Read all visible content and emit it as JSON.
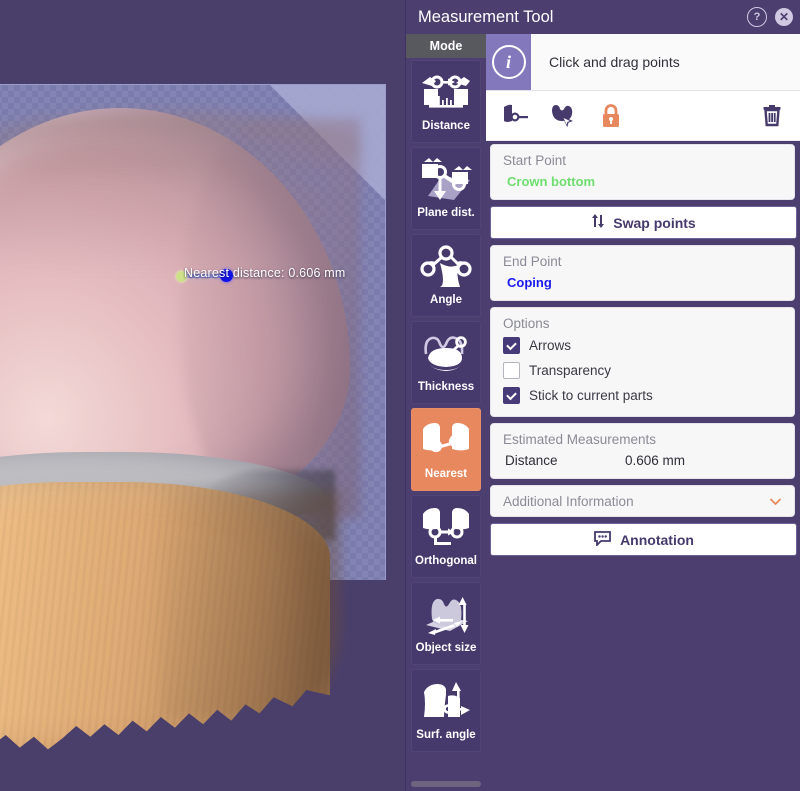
{
  "window": {
    "title": "Measurement Tool",
    "help_icon": "?",
    "close_icon": "✕"
  },
  "rail": {
    "header": "Mode",
    "items": [
      {
        "label": "Distance",
        "icon": "distance-icon",
        "active": false
      },
      {
        "label": "Plane dist.",
        "icon": "plane-distance-icon",
        "active": false
      },
      {
        "label": "Angle",
        "icon": "angle-icon",
        "active": false
      },
      {
        "label": "Thickness",
        "icon": "thickness-icon",
        "active": false
      },
      {
        "label": "Nearest",
        "icon": "nearest-icon",
        "active": true
      },
      {
        "label": "Orthogonal",
        "icon": "orthogonal-icon",
        "active": false
      },
      {
        "label": "Object size",
        "icon": "object-size-icon",
        "active": false
      },
      {
        "label": "Surf. angle",
        "icon": "surface-angle-icon",
        "active": false
      }
    ]
  },
  "info": {
    "icon": "info-icon",
    "text": "Click and drag points"
  },
  "toolbar": {
    "tools": [
      {
        "name": "pick-point-icon"
      },
      {
        "name": "select-part-icon"
      },
      {
        "name": "lock-icon"
      },
      {
        "name": "delete-icon"
      }
    ]
  },
  "start_point": {
    "title": "Start Point",
    "value": "Crown bottom"
  },
  "swap": {
    "label": "Swap points",
    "icon": "swap-arrows-icon"
  },
  "end_point": {
    "title": "End Point",
    "value": "Coping"
  },
  "options": {
    "title": "Options",
    "items": [
      {
        "label": "Arrows",
        "checked": true
      },
      {
        "label": "Transparency",
        "checked": false
      },
      {
        "label": "Stick to current parts",
        "checked": true
      }
    ]
  },
  "estimated": {
    "title": "Estimated Measurements",
    "rows": [
      {
        "key": "Distance",
        "value": "0.606 mm"
      }
    ]
  },
  "additional": {
    "title": "Additional Information",
    "chevron": "⌄"
  },
  "annotation": {
    "label": "Annotation",
    "icon": "speech-bubble-icon"
  },
  "viewport": {
    "measurement_label": "Nearest distance: 0.606 mm",
    "start_point_color": "#cfe08a",
    "end_point_color": "#1111ee",
    "background_color": "#4a3f6b"
  },
  "colors": {
    "panel": "#4c3f70",
    "accent_orange": "#e8885e",
    "mode_tile": "#463a6d",
    "info_bar": "#8278bb"
  }
}
